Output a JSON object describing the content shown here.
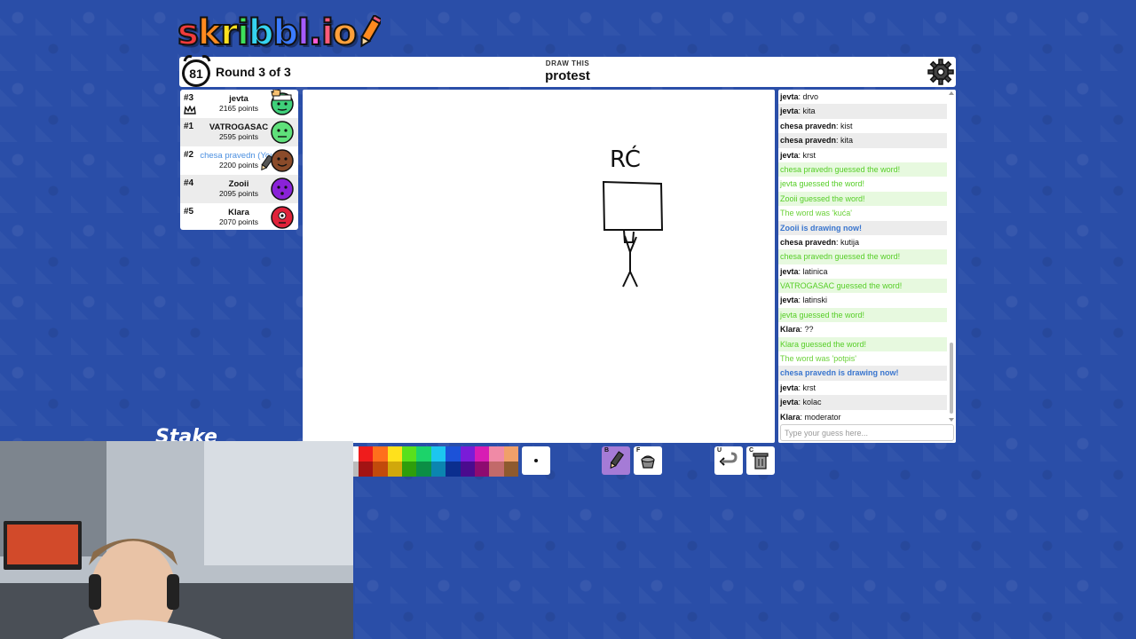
{
  "logo": {
    "text": "skribbl.io"
  },
  "header": {
    "timer": "81",
    "round": "Round 3 of 3",
    "draw_label": "DRAW THIS",
    "word": "protest"
  },
  "players": [
    {
      "rank": "#3",
      "name": "jevta",
      "points": "2165 points",
      "avatar_color": "#3fd07a"
    },
    {
      "rank": "#1",
      "name": "VATROGASAC",
      "points": "2595 points",
      "avatar_color": "#5fe07a"
    },
    {
      "rank": "#2",
      "name": "chesa pravedn (You)",
      "points": "2200 points",
      "avatar_color": "#8a4b2a"
    },
    {
      "rank": "#4",
      "name": "Zooii",
      "points": "2095 points",
      "avatar_color": "#8a22d8"
    },
    {
      "rank": "#5",
      "name": "Klara",
      "points": "2070 points",
      "avatar_color": "#e0223a"
    }
  ],
  "canvas": {
    "drawing_text": "RĆ"
  },
  "chat": {
    "messages": [
      {
        "author": "jevta",
        "text": "drvo",
        "kind": "normal"
      },
      {
        "author": "jevta",
        "text": "kita",
        "kind": "normal"
      },
      {
        "author": "chesa pravedn",
        "text": "kist",
        "kind": "normal"
      },
      {
        "author": "chesa pravedn",
        "text": "kita",
        "kind": "normal"
      },
      {
        "author": "jevta",
        "text": "krst",
        "kind": "normal"
      },
      {
        "author": "",
        "text": "chesa pravedn guessed the word!",
        "kind": "guessed"
      },
      {
        "author": "",
        "text": "jevta guessed the word!",
        "kind": "guessed"
      },
      {
        "author": "",
        "text": "Zooii guessed the word!",
        "kind": "guessed"
      },
      {
        "author": "",
        "text": "The word was 'kuća'",
        "kind": "word"
      },
      {
        "author": "",
        "text": "Zooii is drawing now!",
        "kind": "info"
      },
      {
        "author": "chesa pravedn",
        "text": "kutija",
        "kind": "normal"
      },
      {
        "author": "",
        "text": "chesa pravedn guessed the word!",
        "kind": "guessed"
      },
      {
        "author": "jevta",
        "text": "latinica",
        "kind": "normal"
      },
      {
        "author": "",
        "text": "VATROGASAC guessed the word!",
        "kind": "guessed"
      },
      {
        "author": "jevta",
        "text": "latinski",
        "kind": "normal"
      },
      {
        "author": "",
        "text": "jevta guessed the word!",
        "kind": "guessed"
      },
      {
        "author": "Klara",
        "text": "??",
        "kind": "normal"
      },
      {
        "author": "",
        "text": "Klara guessed the word!",
        "kind": "guessed"
      },
      {
        "author": "",
        "text": "The word was 'potpis'",
        "kind": "word"
      },
      {
        "author": "",
        "text": "chesa pravedn is drawing now!",
        "kind": "info"
      },
      {
        "author": "jevta",
        "text": "krst",
        "kind": "normal"
      },
      {
        "author": "jevta",
        "text": "kolac",
        "kind": "normal"
      },
      {
        "author": "Klara",
        "text": "moderator",
        "kind": "normal"
      }
    ],
    "input_placeholder": "Type your guess here..."
  },
  "palette": {
    "colors": [
      "#ef1c1c",
      "#ff6f1c",
      "#ffe11c",
      "#59e01c",
      "#1cd36a",
      "#1cc6f0",
      "#1c52d8",
      "#7a1cd8",
      "#d81cb4",
      "#f08aa6",
      "#f0a06a",
      "#a31313",
      "#c24a0b",
      "#d1a80b",
      "#2e9e0b",
      "#0b8e45",
      "#0b85b0",
      "#0b2e8e",
      "#4a0b8e",
      "#8e0b70",
      "#c26a6a",
      "#8e5a2e"
    ],
    "tools": [
      {
        "key": "B",
        "name": "brush"
      },
      {
        "key": "F",
        "name": "fill"
      },
      {
        "key": "U",
        "name": "undo"
      },
      {
        "key": "C",
        "name": "clear"
      }
    ]
  },
  "overlay": {
    "stake": "Stake"
  }
}
